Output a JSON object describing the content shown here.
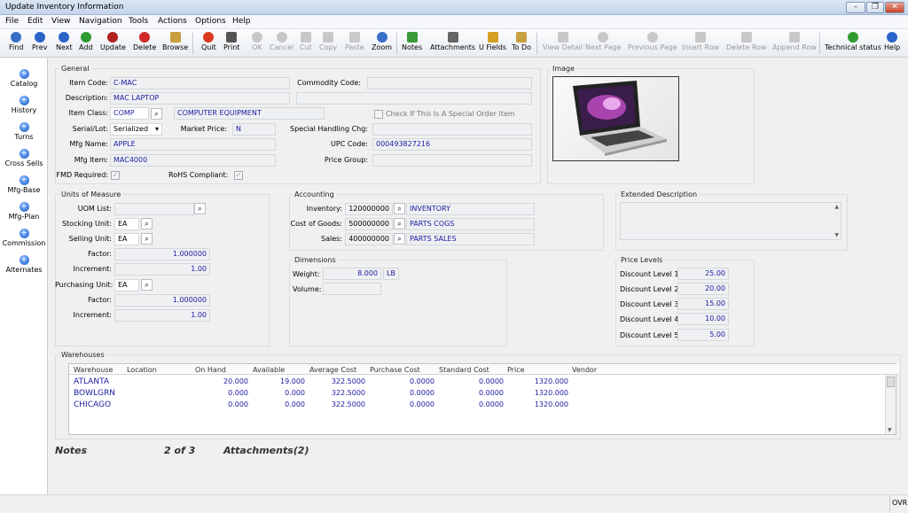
{
  "window": {
    "title": "Update Inventory Information"
  },
  "menu": [
    "File",
    "Edit",
    "View",
    "Navigation",
    "Tools",
    "Actions",
    "Options",
    "Help"
  ],
  "toolbar": {
    "find": "Find",
    "prev": "Prev",
    "next": "Next",
    "add": "Add",
    "update": "Update",
    "delete": "Delete",
    "browse": "Browse",
    "quit": "Quit",
    "print": "Print",
    "ok": "OK",
    "cancel": "Cancel",
    "cut": "Cut",
    "copy": "Copy",
    "paste": "Paste",
    "zoom": "Zoom",
    "notes": "Notes",
    "attachments": "Attachments",
    "ufields": "U Fields",
    "todo": "To Do",
    "view_detail": "View Detail",
    "next_page": "Next Page",
    "previous_page": "Previous Page",
    "insert_row": "Insert Row",
    "delete_row": "Delete Row",
    "append_row": "Append Row",
    "technical_status": "Technical status",
    "help": "Help"
  },
  "sidebar": [
    "Catalog",
    "History",
    "Turns",
    "Cross Sells",
    "Mfg-Base",
    "Mfg-Plan",
    "Commission",
    "Alternates"
  ],
  "general": {
    "title": "General",
    "item_code_label": "Item Code:",
    "item_code": "C-MAC",
    "commodity_code_label": "Commodity Code:",
    "commodity_code": "",
    "description_label": "Description:",
    "description": "MAC LAPTOP",
    "item_class_label": "Item Class:",
    "item_class": "COMP",
    "item_class_desc": "COMPUTER EQUIPMENT",
    "special_order_label": "Check If This Is A Special Order Item",
    "serial_lot_label": "Serial/Lot:",
    "serial_lot": "Serialized",
    "market_price_label": "Market Price:",
    "market_price": "N",
    "special_handling_label": "Special Handling Chg:",
    "mfg_name_label": "Mfg Name:",
    "mfg_name": "APPLE",
    "upc_label": "UPC Code:",
    "upc": "000493827216",
    "mfg_item_label": "Mfg Item:",
    "mfg_item": "MAC4000",
    "price_group_label": "Price Group:",
    "fmd_label": "FMD Required:",
    "rohs_label": "RoHS Compliant:"
  },
  "image": {
    "title": "Image"
  },
  "uom": {
    "title": "Units of Measure",
    "uom_list_label": "UOM List:",
    "stocking_label": "Stocking Unit:",
    "stocking": "EA",
    "selling_label": "Selling Unit:",
    "selling": "EA",
    "factor_label": "Factor:",
    "factor": "1.000000",
    "increment_label": "Increment:",
    "increment": "1.00",
    "purchasing_label": "Purchasing Unit:",
    "purchasing": "EA",
    "pfactor_label": "Factor:",
    "pfactor": "1.000000",
    "pincrement_label": "Increment:",
    "pincrement": "1.00"
  },
  "accounting": {
    "title": "Accounting",
    "inventory_label": "Inventory:",
    "inventory": "120000000",
    "inventory_desc": "INVENTORY",
    "cogs_label": "Cost of Goods:",
    "cogs": "500000000",
    "cogs_desc": "PARTS COGS",
    "sales_label": "Sales:",
    "sales": "400000000",
    "sales_desc": "PARTS SALES"
  },
  "dimensions": {
    "title": "Dimensions",
    "weight_label": "Weight:",
    "weight": "8.000",
    "weight_unit": "LB",
    "volume_label": "Volume:"
  },
  "extended": {
    "title": "Extended Description"
  },
  "price_levels": {
    "title": "Price Levels",
    "levels": [
      {
        "label": "Discount Level 1:",
        "value": "25.00"
      },
      {
        "label": "Discount Level 2:",
        "value": "20.00"
      },
      {
        "label": "Discount Level 3:",
        "value": "15.00"
      },
      {
        "label": "Discount Level 4:",
        "value": "10.00"
      },
      {
        "label": "Discount Level 5:",
        "value": "5.00"
      }
    ]
  },
  "warehouses": {
    "title": "Warehouses",
    "columns": [
      "Warehouse",
      "Location",
      "On Hand",
      "Available",
      "Average Cost",
      "Purchase Cost",
      "Standard Cost",
      "Price",
      "Vendor"
    ],
    "rows": [
      {
        "warehouse": "ATLANTA",
        "on_hand": "20.000",
        "available": "19.000",
        "avg": "322.5000",
        "purchase": "0.0000",
        "standard": "0.0000",
        "price": "1320.000"
      },
      {
        "warehouse": "BOWLGRN",
        "on_hand": "0.000",
        "available": "0.000",
        "avg": "322.5000",
        "purchase": "0.0000",
        "standard": "0.0000",
        "price": "1320.000"
      },
      {
        "warehouse": "CHICAGO",
        "on_hand": "0.000",
        "available": "0.000",
        "avg": "322.5000",
        "purchase": "0.0000",
        "standard": "0.0000",
        "price": "1320.000"
      }
    ]
  },
  "footer": {
    "notes": "Notes",
    "record": "2 of 3",
    "attachments": "Attachments(2)"
  },
  "status": {
    "ovr": "OVR"
  }
}
